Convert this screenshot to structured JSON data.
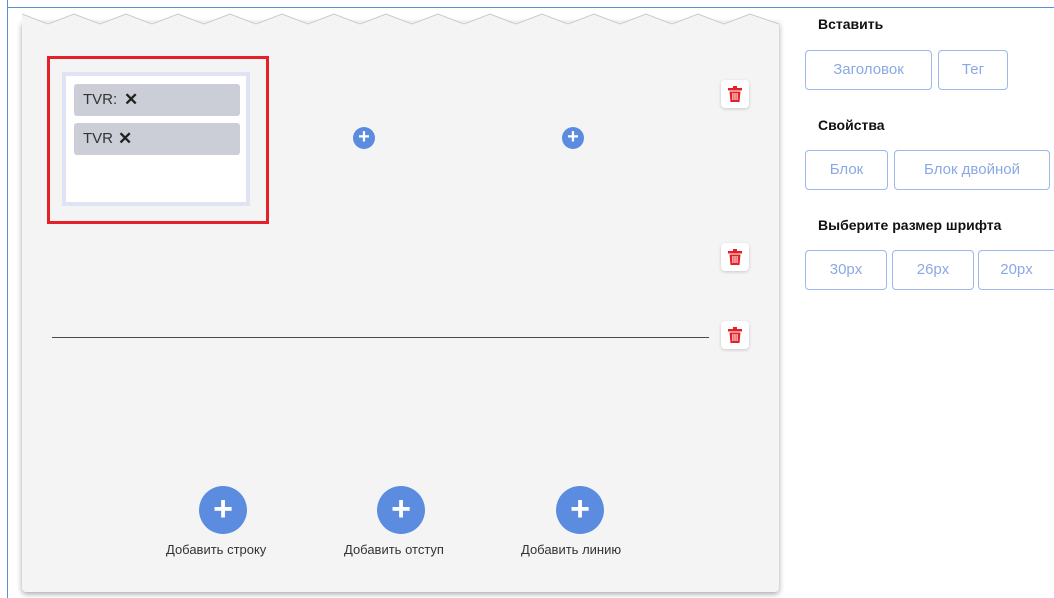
{
  "canvas": {
    "tag_block": {
      "chips": [
        {
          "label": "TVR:",
          "remove_glyph": "✕"
        },
        {
          "label": "TVR",
          "remove_glyph": "✕"
        }
      ]
    },
    "icons": {
      "add_small": "+",
      "add_large": "+",
      "delete": "trash-icon"
    },
    "bottom_actions": {
      "add_row_label": "Добавить строку",
      "add_indent_label": "Добавить отступ",
      "add_line_label": "Добавить линию"
    }
  },
  "sidebar": {
    "insert": {
      "title": "Вставить",
      "buttons": [
        "Заголовок",
        "Тег"
      ]
    },
    "properties": {
      "title": "Свойства",
      "buttons": [
        "Блок",
        "Блок двойной"
      ]
    },
    "font_size": {
      "title": "Выберите размер шрифта",
      "buttons": [
        "30px",
        "26px",
        "20px"
      ]
    }
  },
  "colors": {
    "accent": "#5b8ce0",
    "delete": "#e52029",
    "highlight": "#e52029",
    "outline_button_text": "#8aa9e4"
  }
}
